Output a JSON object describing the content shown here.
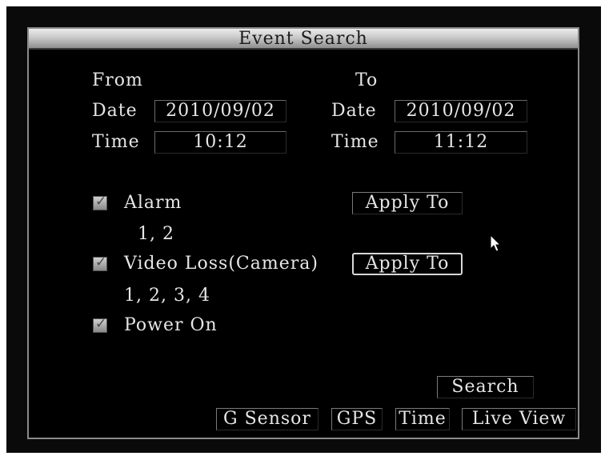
{
  "dialog": {
    "title": "Event Search"
  },
  "range": {
    "from_label": "From",
    "to_label": "To",
    "date_label": "Date",
    "time_label": "Time",
    "from_date": "2010/09/02",
    "from_time": "10:12",
    "to_date": "2010/09/02",
    "to_time": "11:12"
  },
  "events": {
    "alarm": {
      "label": "Alarm",
      "checked": true,
      "channels": "1, 2",
      "apply_label": "Apply To"
    },
    "video_loss": {
      "label": "Video Loss(Camera)",
      "checked": true,
      "channels": "1, 2, 3, 4",
      "apply_label": "Apply To"
    },
    "power_on": {
      "label": "Power On",
      "checked": true
    }
  },
  "actions": {
    "search_label": "Search"
  },
  "bottom_tabs": {
    "g_sensor": "G Sensor",
    "gps": "GPS",
    "time": "Time",
    "live_view": "Live View"
  },
  "icons": {
    "checkbox": "checkmark-icon",
    "cursor": "mouse-pointer-icon"
  }
}
